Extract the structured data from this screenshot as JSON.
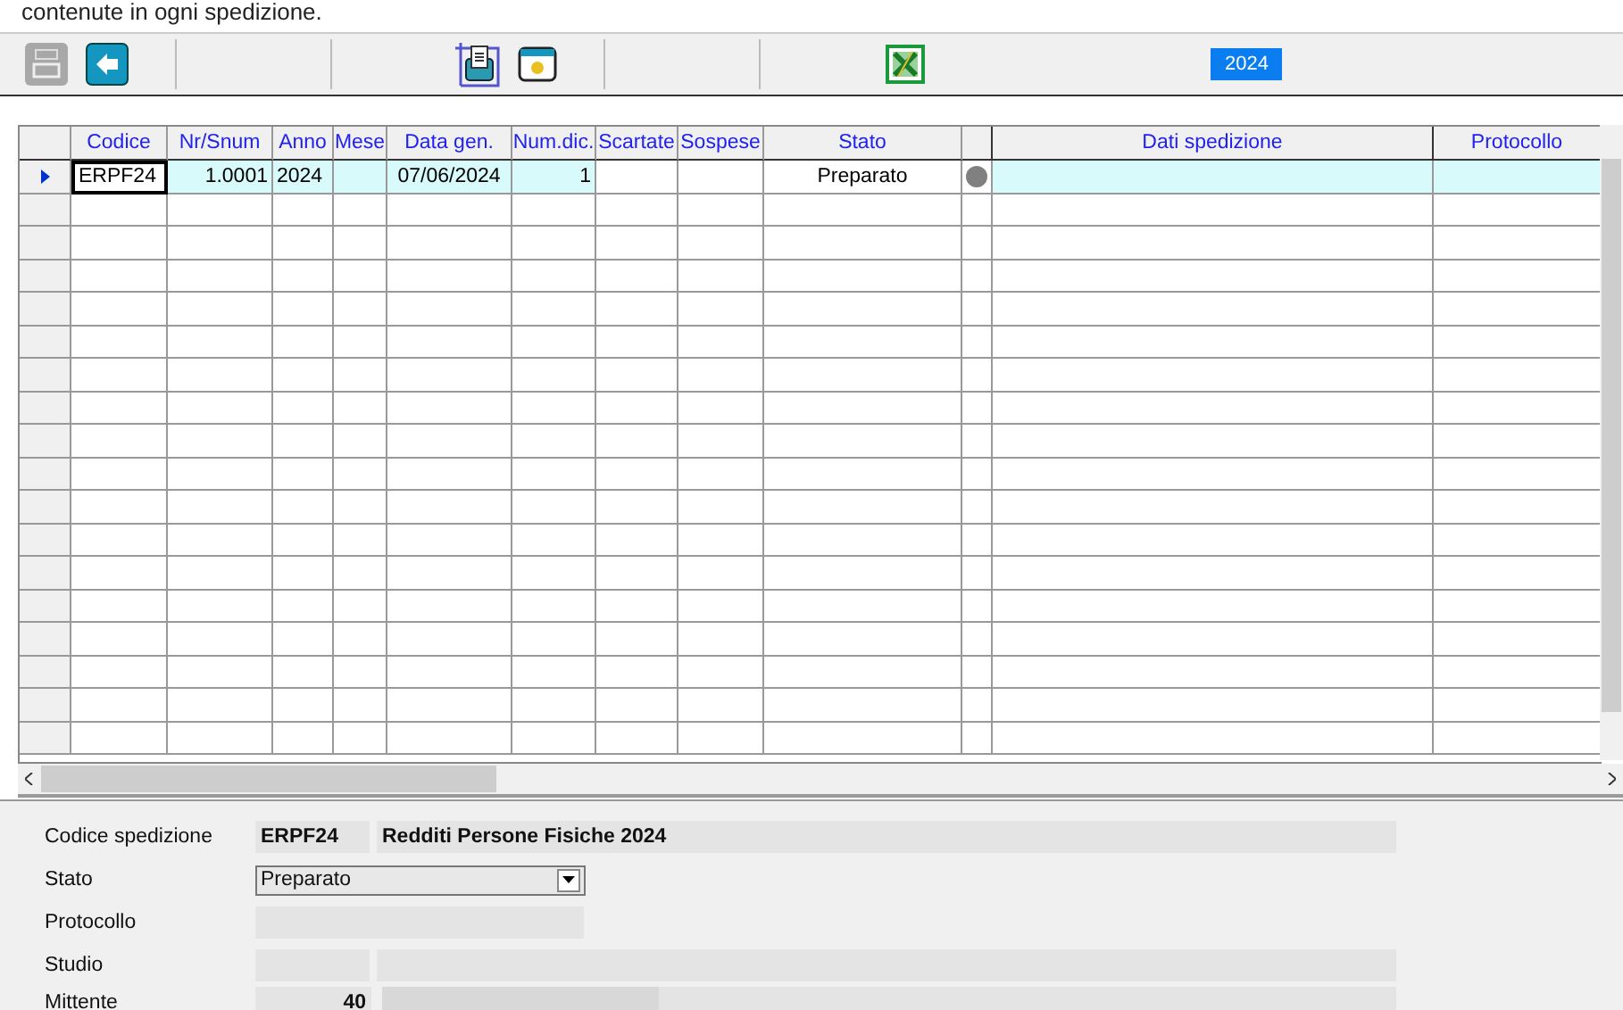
{
  "caption": "contenute in ogni spedizione.",
  "toolbar": {
    "buttons": [
      {
        "kind": "printer",
        "disabled": true
      },
      {
        "kind": "back"
      },
      {
        "kind": "sep"
      },
      {
        "kind": "sep"
      },
      {
        "kind": "import"
      },
      {
        "kind": "window"
      },
      {
        "kind": "sep"
      },
      {
        "kind": "sep"
      },
      {
        "kind": "excel"
      }
    ],
    "year": "2024"
  },
  "table": {
    "columns": [
      {
        "label": "Codice"
      },
      {
        "label": "Nr/Snum"
      },
      {
        "label": "Anno"
      },
      {
        "label": "Mese"
      },
      {
        "label": "Data gen."
      },
      {
        "label": "Num.dic."
      },
      {
        "label": "Scartate"
      },
      {
        "label": "Sospese"
      },
      {
        "label": "Stato"
      },
      {},
      {
        "label": "Dati spedizione"
      },
      {
        "label": "Protocollo"
      }
    ],
    "rows": [
      {
        "selected": true,
        "cells": [
          "ERPF24",
          "1.0001",
          "2024",
          "",
          "07/06/2024",
          "1",
          "",
          "",
          "Preparato",
          "",
          "",
          ""
        ],
        "color": "#808080"
      }
    ]
  },
  "form": {
    "codice_spedizione": {
      "label": "Codice spedizione",
      "code": "ERPF24",
      "description": "Redditi Persone Fisiche 2024"
    },
    "stato": {
      "label": "Stato",
      "value": "Preparato"
    },
    "protocollo": {
      "label": "Protocollo"
    },
    "studio": {
      "label": "Studio"
    },
    "mittente": {
      "label": "Mittente",
      "code": "40"
    }
  }
}
